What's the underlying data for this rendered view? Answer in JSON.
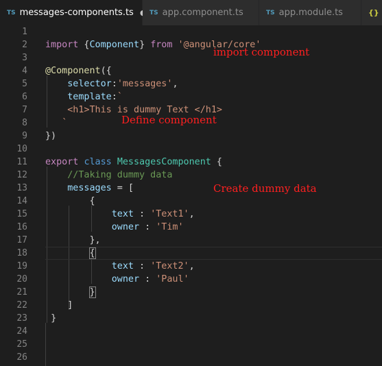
{
  "tabs": [
    {
      "badge": "TS",
      "label": "messages-components.ts",
      "dirty_marker": "●"
    },
    {
      "badge": "TS",
      "label": "app.component.ts"
    },
    {
      "badge": "TS",
      "label": "app.module.ts"
    },
    {
      "badge": "{}"
    }
  ],
  "line_numbers": [
    "1",
    "2",
    "3",
    "4",
    "5",
    "6",
    "7",
    "8",
    "9",
    "10",
    "11",
    "12",
    "13",
    "14",
    "15",
    "16",
    "17",
    "18",
    "19",
    "20",
    "21",
    "22",
    "23",
    "24",
    "25",
    "26"
  ],
  "code": {
    "l2": {
      "kw1": "import",
      "b1": " {",
      "cls": "Component",
      "b2": "} ",
      "kw2": "from",
      "sp": " ",
      "str": "'@angular/core'"
    },
    "l4": {
      "dec": "@Component",
      "rest": "({"
    },
    "l5": {
      "indent": "    ",
      "prop": "selector",
      "colon": ":",
      "str": "'messages'",
      "comma": ","
    },
    "l6": {
      "indent": "    ",
      "prop": "template",
      "colon": ":",
      "str": "`"
    },
    "l7": {
      "indent": "    ",
      "str": "<h1>This is dummy Text </h1>"
    },
    "l8": {
      "indent": "   ",
      "str": "`"
    },
    "l9": {
      "text": "})"
    },
    "l11": {
      "kw1": "export",
      "sp1": " ",
      "kw2": "class",
      "sp2": " ",
      "cls": "MessagesComponent",
      "rest": " {"
    },
    "l12": {
      "indent": "    ",
      "cmt": "//Taking dummy data"
    },
    "l13": {
      "indent": "    ",
      "prop": "messages",
      "rest": " = ["
    },
    "l14": {
      "indent": "        ",
      "text": "{"
    },
    "l15": {
      "indent": "            ",
      "prop": "text",
      "mid": " : ",
      "str": "'Text1'",
      "end": ","
    },
    "l16": {
      "indent": "            ",
      "prop": "owner",
      "mid": " : ",
      "str": "'Tim'"
    },
    "l17": {
      "indent": "        ",
      "text": "},"
    },
    "l18": {
      "indent": "        ",
      "brk": "{"
    },
    "l19": {
      "indent": "            ",
      "prop": "text",
      "mid": " : ",
      "str": "'Text2'",
      "end": ","
    },
    "l20": {
      "indent": "            ",
      "prop": "owner",
      "mid": " : ",
      "str": "'Paul'"
    },
    "l21": {
      "indent": "        ",
      "brk": "}"
    },
    "l22": {
      "indent": "    ",
      "text": "]"
    },
    "l23": {
      "indent": " ",
      "text": "}"
    }
  },
  "annotations": {
    "import": "import  component",
    "define": "Define  component",
    "create": "Create  dummy  data"
  },
  "colors": {
    "background": "#1e1e1e",
    "keyword": "#c586c0",
    "keyword_blue": "#569cd6",
    "string": "#ce9178",
    "property": "#9cdcfe",
    "class": "#4ec9b0",
    "comment": "#6a9955",
    "annotation": "#ff2020"
  }
}
